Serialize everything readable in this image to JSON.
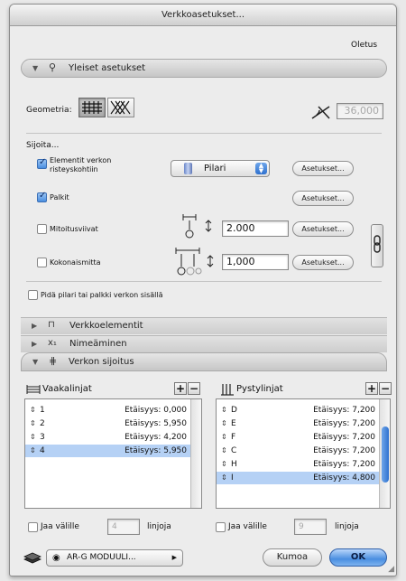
{
  "window": {
    "title": "Verkkoasetukset..."
  },
  "header": {
    "preset_label": "Oletus"
  },
  "general": {
    "section_title": "Yleiset asetukset",
    "geometry_label": "Geometria:",
    "angle_value": "36,000"
  },
  "placement": {
    "heading": "Sijoita...",
    "elements_label_line1": "Elementit verkon",
    "elements_label_line2": "risteyskohtiin",
    "elements_checked": true,
    "column_popup_value": "Pilari",
    "settings_label": "Asetukset...",
    "beams_label": "Palkit",
    "beams_checked": true,
    "dim_lines_label": "Mitoitusviivat",
    "dim_lines_checked": false,
    "dim_offset_value": "2.000",
    "overall_dim_label": "Kokonaismitta",
    "overall_dim_checked": false,
    "overall_offset_value": "1,000",
    "keep_inside_label": "Pidä pilari tai palkki verkon sisällä",
    "keep_inside_checked": false
  },
  "sections": {
    "grid_elements": "Verkkoelementit",
    "naming": "Nimeäminen",
    "grid_placement": "Verkon sijoitus"
  },
  "horizontal": {
    "title": "Vaakalinjat",
    "rows": [
      {
        "name": "1",
        "distance": "Etäisyys: 0,000",
        "selected": false
      },
      {
        "name": "2",
        "distance": "Etäisyys: 5,950",
        "selected": false
      },
      {
        "name": "3",
        "distance": "Etäisyys: 4,200",
        "selected": false
      },
      {
        "name": "4",
        "distance": "Etäisyys: 5,950",
        "selected": true
      }
    ],
    "divide_label": "Jaa välille",
    "divide_value": "4",
    "lines_label": "linjoja"
  },
  "vertical": {
    "title": "Pystylinjat",
    "rows": [
      {
        "name": "D",
        "distance": "Etäisyys: 7,200",
        "selected": false
      },
      {
        "name": "E",
        "distance": "Etäisyys: 7,200",
        "selected": false
      },
      {
        "name": "F",
        "distance": "Etäisyys: 7,200",
        "selected": false
      },
      {
        "name": "C",
        "distance": "Etäisyys: 7,200",
        "selected": false
      },
      {
        "name": "H",
        "distance": "Etäisyys: 7,200",
        "selected": false
      },
      {
        "name": "I",
        "distance": "Etäisyys: 4,800",
        "selected": true
      }
    ],
    "divide_label": "Jaa välille",
    "divide_value": "9",
    "lines_label": "linjoja"
  },
  "footer": {
    "layer_popup": "AR-G MODUULI...",
    "cancel_label": "Kumoa",
    "ok_label": "OK"
  },
  "colors": {
    "accent": "#4a8ee0",
    "selection": "#b5d1f5"
  },
  "icons": [
    "pin-icon",
    "grid-orthogonal-icon",
    "grid-oblique-icon",
    "angle-icon",
    "column-icon",
    "dimension-offset-icon",
    "chain-link-icon",
    "grid-elements-icon",
    "naming-icon",
    "grid-placement-icon",
    "horizontal-lines-icon",
    "vertical-lines-icon",
    "layer-icon",
    "eye-icon"
  ]
}
